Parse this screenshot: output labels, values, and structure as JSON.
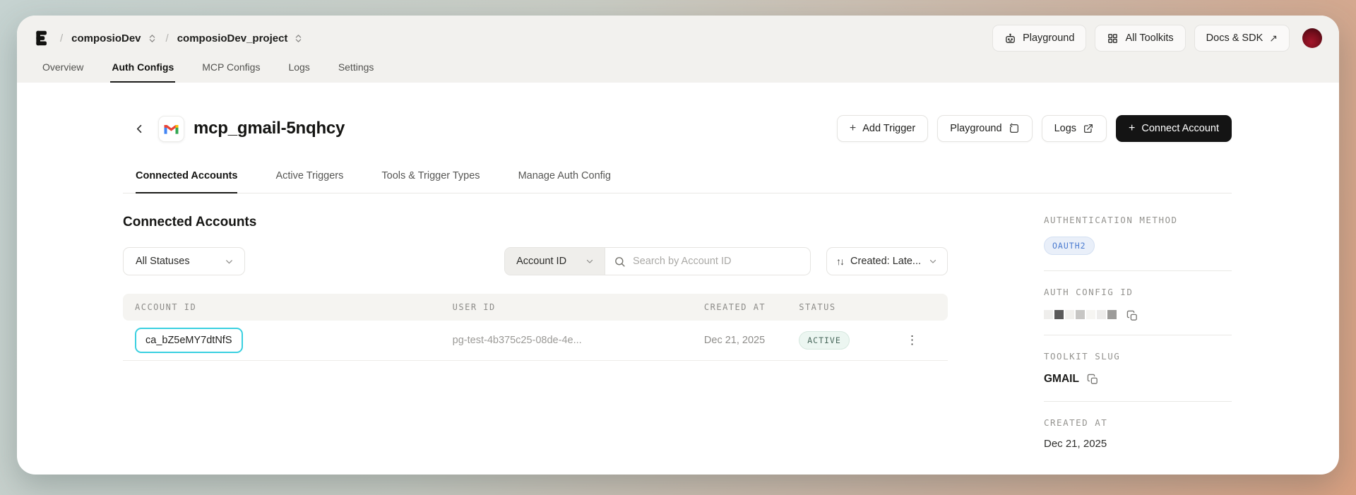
{
  "topbar": {
    "breadcrumb": {
      "separator": "/",
      "org": "composioDev",
      "project": "composioDev_project"
    },
    "playground_label": "Playground",
    "all_toolkits_label": "All Toolkits",
    "docs_sdk_label": "Docs & SDK",
    "docs_sdk_arrow": "↗"
  },
  "nav_tabs": [
    {
      "label": "Overview"
    },
    {
      "label": "Auth Configs"
    },
    {
      "label": "MCP Configs"
    },
    {
      "label": "Logs"
    },
    {
      "label": "Settings"
    }
  ],
  "page": {
    "title": "mcp_gmail-5nqhcy",
    "plus": "+",
    "add_trigger_label": "Add Trigger",
    "playground_label": "Playground",
    "logs_label": "Logs",
    "connect_account_label": "Connect Account"
  },
  "detail_tabs": [
    {
      "label": "Connected Accounts"
    },
    {
      "label": "Active Triggers"
    },
    {
      "label": "Tools & Trigger Types"
    },
    {
      "label": "Manage Auth Config"
    }
  ],
  "section": {
    "heading": "Connected Accounts",
    "status_filter": "All Statuses",
    "search_field": "Account ID",
    "search_placeholder": "Search by Account ID",
    "sort_icon": "↑↓",
    "sort_label": "Created: Late..."
  },
  "table": {
    "columns": [
      "ACCOUNT ID",
      "USER ID",
      "CREATED AT",
      "STATUS"
    ],
    "kebab": "⋮",
    "rows": [
      {
        "account_id": "ca_bZ5eMY7dtNfS",
        "user_id": "pg-test-4b375c25-08de-4e...",
        "created_at": "Dec 21, 2025",
        "status": "ACTIVE"
      }
    ]
  },
  "sidebar": {
    "auth_method_label": "AUTHENTICATION METHOD",
    "auth_method_value": "OAUTH2",
    "auth_config_id_label": "AUTH CONFIG ID",
    "toolkit_slug_label": "TOOLKIT SLUG",
    "toolkit_slug_value": "GMAIL",
    "created_at_label": "CREATED AT",
    "created_at_value": "Dec 21, 2025"
  },
  "colors": {
    "highlight_cyan": "#3ad0e0",
    "status_active_text": "#49685c",
    "status_active_bg": "#ecf6f1",
    "oauth_badge_text": "#4b7bd0",
    "oauth_badge_bg": "#e9eff9",
    "connect_button_bg": "#141414",
    "avatar_red": "#7c0f1e",
    "bg_gradient_start": "#c6d3d1",
    "bg_gradient_end": "#d9a081"
  }
}
